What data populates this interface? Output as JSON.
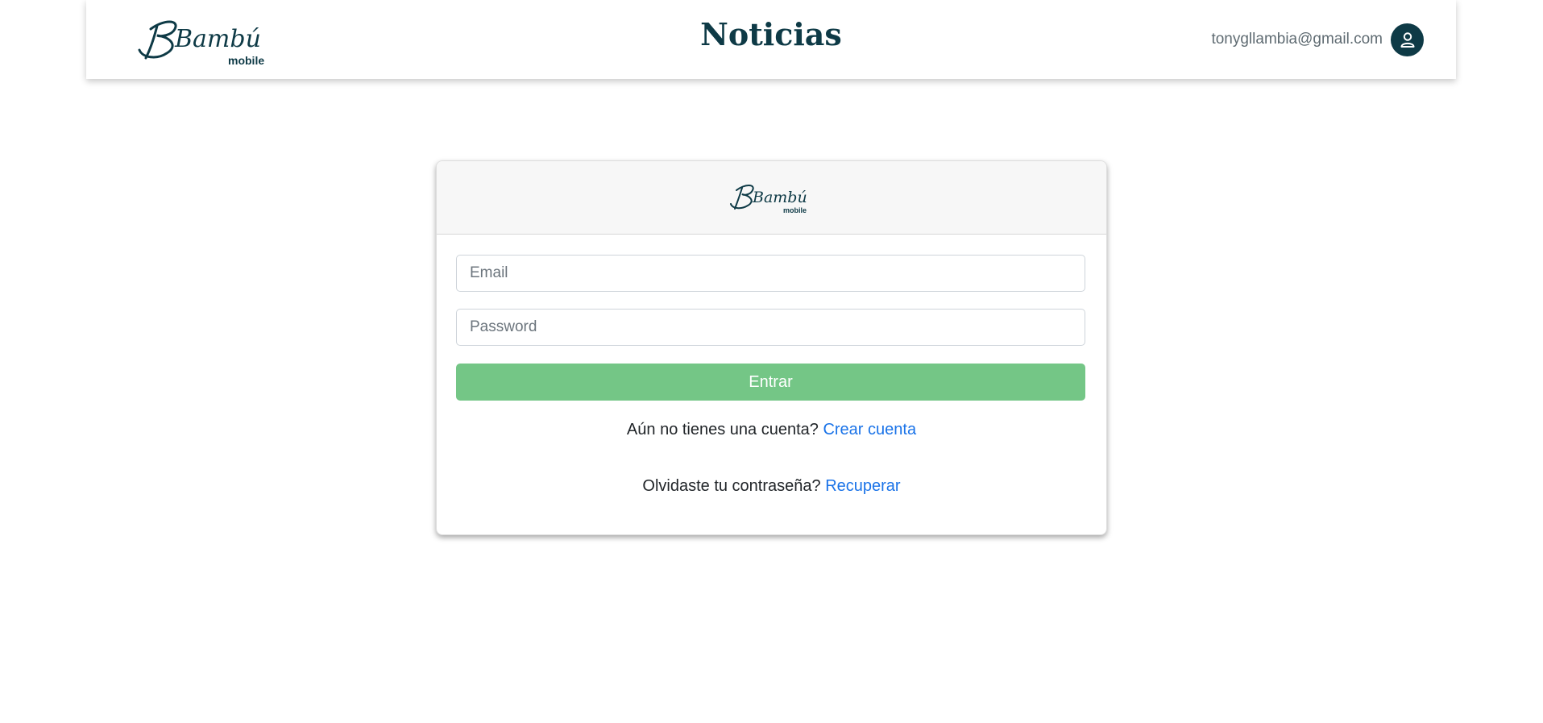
{
  "header": {
    "logo_text": "Bambú",
    "logo_subtext": "mobile",
    "title": "Noticias",
    "user_email": "tonygllambia@gmail.com",
    "avatar_icon": "user-icon"
  },
  "login_card": {
    "logo_text": "Bambú",
    "logo_subtext": "mobile",
    "email_placeholder": "Email",
    "email_value": "",
    "password_placeholder": "Password",
    "password_value": "",
    "submit_label": "Entrar",
    "signup_prompt": "Aún no tienes una cuenta?",
    "signup_link": "Crear cuenta",
    "recover_prompt": "Olvidaste tu contraseña?",
    "recover_link": "Recuperar"
  },
  "colors": {
    "brand": "#0e3a46",
    "button": "#74c686",
    "link": "#1a73e8"
  }
}
